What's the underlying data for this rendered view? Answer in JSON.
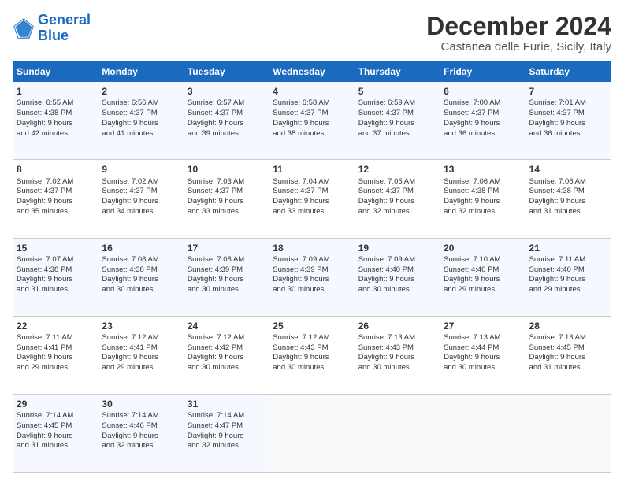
{
  "logo": {
    "line1": "General",
    "line2": "Blue"
  },
  "title": "December 2024",
  "subtitle": "Castanea delle Furie, Sicily, Italy",
  "weekdays": [
    "Sunday",
    "Monday",
    "Tuesday",
    "Wednesday",
    "Thursday",
    "Friday",
    "Saturday"
  ],
  "weeks": [
    [
      {
        "day": 1,
        "lines": [
          "Sunrise: 6:55 AM",
          "Sunset: 4:38 PM",
          "Daylight: 9 hours",
          "and 42 minutes."
        ]
      },
      {
        "day": 2,
        "lines": [
          "Sunrise: 6:56 AM",
          "Sunset: 4:37 PM",
          "Daylight: 9 hours",
          "and 41 minutes."
        ]
      },
      {
        "day": 3,
        "lines": [
          "Sunrise: 6:57 AM",
          "Sunset: 4:37 PM",
          "Daylight: 9 hours",
          "and 39 minutes."
        ]
      },
      {
        "day": 4,
        "lines": [
          "Sunrise: 6:58 AM",
          "Sunset: 4:37 PM",
          "Daylight: 9 hours",
          "and 38 minutes."
        ]
      },
      {
        "day": 5,
        "lines": [
          "Sunrise: 6:59 AM",
          "Sunset: 4:37 PM",
          "Daylight: 9 hours",
          "and 37 minutes."
        ]
      },
      {
        "day": 6,
        "lines": [
          "Sunrise: 7:00 AM",
          "Sunset: 4:37 PM",
          "Daylight: 9 hours",
          "and 36 minutes."
        ]
      },
      {
        "day": 7,
        "lines": [
          "Sunrise: 7:01 AM",
          "Sunset: 4:37 PM",
          "Daylight: 9 hours",
          "and 36 minutes."
        ]
      }
    ],
    [
      {
        "day": 8,
        "lines": [
          "Sunrise: 7:02 AM",
          "Sunset: 4:37 PM",
          "Daylight: 9 hours",
          "and 35 minutes."
        ]
      },
      {
        "day": 9,
        "lines": [
          "Sunrise: 7:02 AM",
          "Sunset: 4:37 PM",
          "Daylight: 9 hours",
          "and 34 minutes."
        ]
      },
      {
        "day": 10,
        "lines": [
          "Sunrise: 7:03 AM",
          "Sunset: 4:37 PM",
          "Daylight: 9 hours",
          "and 33 minutes."
        ]
      },
      {
        "day": 11,
        "lines": [
          "Sunrise: 7:04 AM",
          "Sunset: 4:37 PM",
          "Daylight: 9 hours",
          "and 33 minutes."
        ]
      },
      {
        "day": 12,
        "lines": [
          "Sunrise: 7:05 AM",
          "Sunset: 4:37 PM",
          "Daylight: 9 hours",
          "and 32 minutes."
        ]
      },
      {
        "day": 13,
        "lines": [
          "Sunrise: 7:06 AM",
          "Sunset: 4:38 PM",
          "Daylight: 9 hours",
          "and 32 minutes."
        ]
      },
      {
        "day": 14,
        "lines": [
          "Sunrise: 7:06 AM",
          "Sunset: 4:38 PM",
          "Daylight: 9 hours",
          "and 31 minutes."
        ]
      }
    ],
    [
      {
        "day": 15,
        "lines": [
          "Sunrise: 7:07 AM",
          "Sunset: 4:38 PM",
          "Daylight: 9 hours",
          "and 31 minutes."
        ]
      },
      {
        "day": 16,
        "lines": [
          "Sunrise: 7:08 AM",
          "Sunset: 4:38 PM",
          "Daylight: 9 hours",
          "and 30 minutes."
        ]
      },
      {
        "day": 17,
        "lines": [
          "Sunrise: 7:08 AM",
          "Sunset: 4:39 PM",
          "Daylight: 9 hours",
          "and 30 minutes."
        ]
      },
      {
        "day": 18,
        "lines": [
          "Sunrise: 7:09 AM",
          "Sunset: 4:39 PM",
          "Daylight: 9 hours",
          "and 30 minutes."
        ]
      },
      {
        "day": 19,
        "lines": [
          "Sunrise: 7:09 AM",
          "Sunset: 4:40 PM",
          "Daylight: 9 hours",
          "and 30 minutes."
        ]
      },
      {
        "day": 20,
        "lines": [
          "Sunrise: 7:10 AM",
          "Sunset: 4:40 PM",
          "Daylight: 9 hours",
          "and 29 minutes."
        ]
      },
      {
        "day": 21,
        "lines": [
          "Sunrise: 7:11 AM",
          "Sunset: 4:40 PM",
          "Daylight: 9 hours",
          "and 29 minutes."
        ]
      }
    ],
    [
      {
        "day": 22,
        "lines": [
          "Sunrise: 7:11 AM",
          "Sunset: 4:41 PM",
          "Daylight: 9 hours",
          "and 29 minutes."
        ]
      },
      {
        "day": 23,
        "lines": [
          "Sunrise: 7:12 AM",
          "Sunset: 4:41 PM",
          "Daylight: 9 hours",
          "and 29 minutes."
        ]
      },
      {
        "day": 24,
        "lines": [
          "Sunrise: 7:12 AM",
          "Sunset: 4:42 PM",
          "Daylight: 9 hours",
          "and 30 minutes."
        ]
      },
      {
        "day": 25,
        "lines": [
          "Sunrise: 7:12 AM",
          "Sunset: 4:43 PM",
          "Daylight: 9 hours",
          "and 30 minutes."
        ]
      },
      {
        "day": 26,
        "lines": [
          "Sunrise: 7:13 AM",
          "Sunset: 4:43 PM",
          "Daylight: 9 hours",
          "and 30 minutes."
        ]
      },
      {
        "day": 27,
        "lines": [
          "Sunrise: 7:13 AM",
          "Sunset: 4:44 PM",
          "Daylight: 9 hours",
          "and 30 minutes."
        ]
      },
      {
        "day": 28,
        "lines": [
          "Sunrise: 7:13 AM",
          "Sunset: 4:45 PM",
          "Daylight: 9 hours",
          "and 31 minutes."
        ]
      }
    ],
    [
      {
        "day": 29,
        "lines": [
          "Sunrise: 7:14 AM",
          "Sunset: 4:45 PM",
          "Daylight: 9 hours",
          "and 31 minutes."
        ]
      },
      {
        "day": 30,
        "lines": [
          "Sunrise: 7:14 AM",
          "Sunset: 4:46 PM",
          "Daylight: 9 hours",
          "and 32 minutes."
        ]
      },
      {
        "day": 31,
        "lines": [
          "Sunrise: 7:14 AM",
          "Sunset: 4:47 PM",
          "Daylight: 9 hours",
          "and 32 minutes."
        ]
      },
      null,
      null,
      null,
      null
    ]
  ]
}
